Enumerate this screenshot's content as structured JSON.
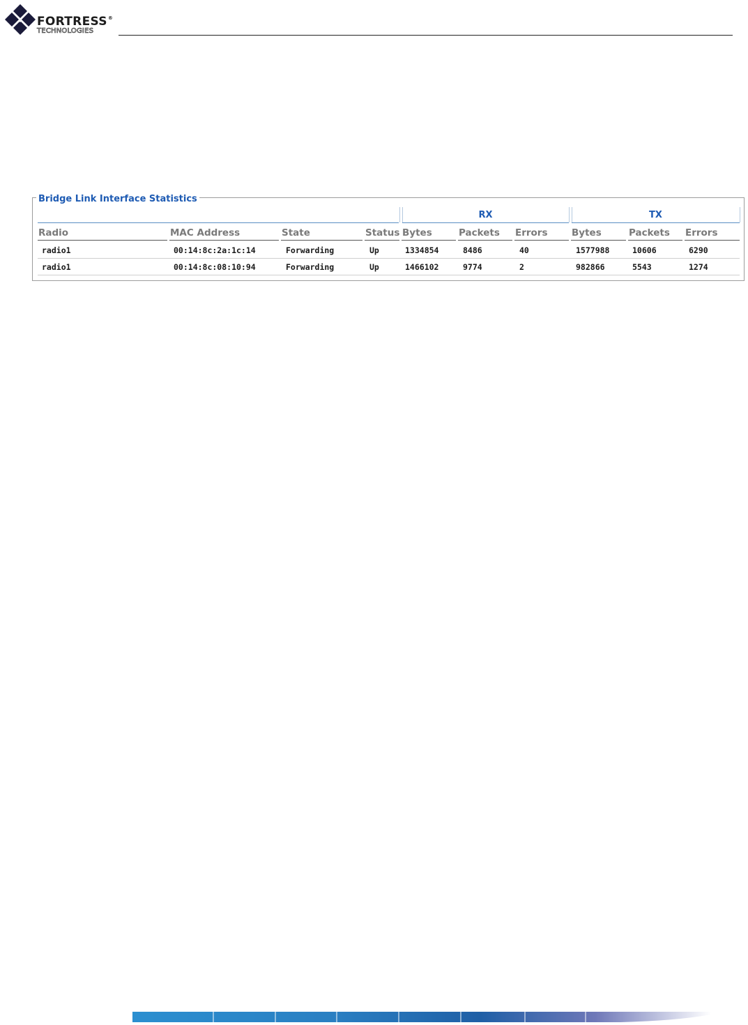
{
  "header": {
    "brand_name": "FORTRESS",
    "brand_reg": "®",
    "brand_sub": "TECHNOLOGIES"
  },
  "panel": {
    "title": "Bridge Link Interface Statistics",
    "group_rx": "RX",
    "group_tx": "TX",
    "columns": [
      "Radio",
      "MAC Address",
      "State",
      "Status",
      "Bytes",
      "Packets",
      "Errors",
      "Bytes",
      "Packets",
      "Errors"
    ],
    "rows": [
      [
        "radio1",
        "00:14:8c:2a:1c:14",
        "Forwarding",
        "Up",
        "1334854",
        "8486",
        "40",
        "1577988",
        "10606",
        "6290"
      ],
      [
        "radio1",
        "00:14:8c:08:10:94",
        "Forwarding",
        "Up",
        "1466102",
        "9774",
        "2",
        "982866",
        "5543",
        "1274"
      ]
    ]
  },
  "colors": {
    "accent": "#1e5bb3",
    "header_text": "#7a7a7a",
    "panel_border": "#9c9c9c"
  }
}
